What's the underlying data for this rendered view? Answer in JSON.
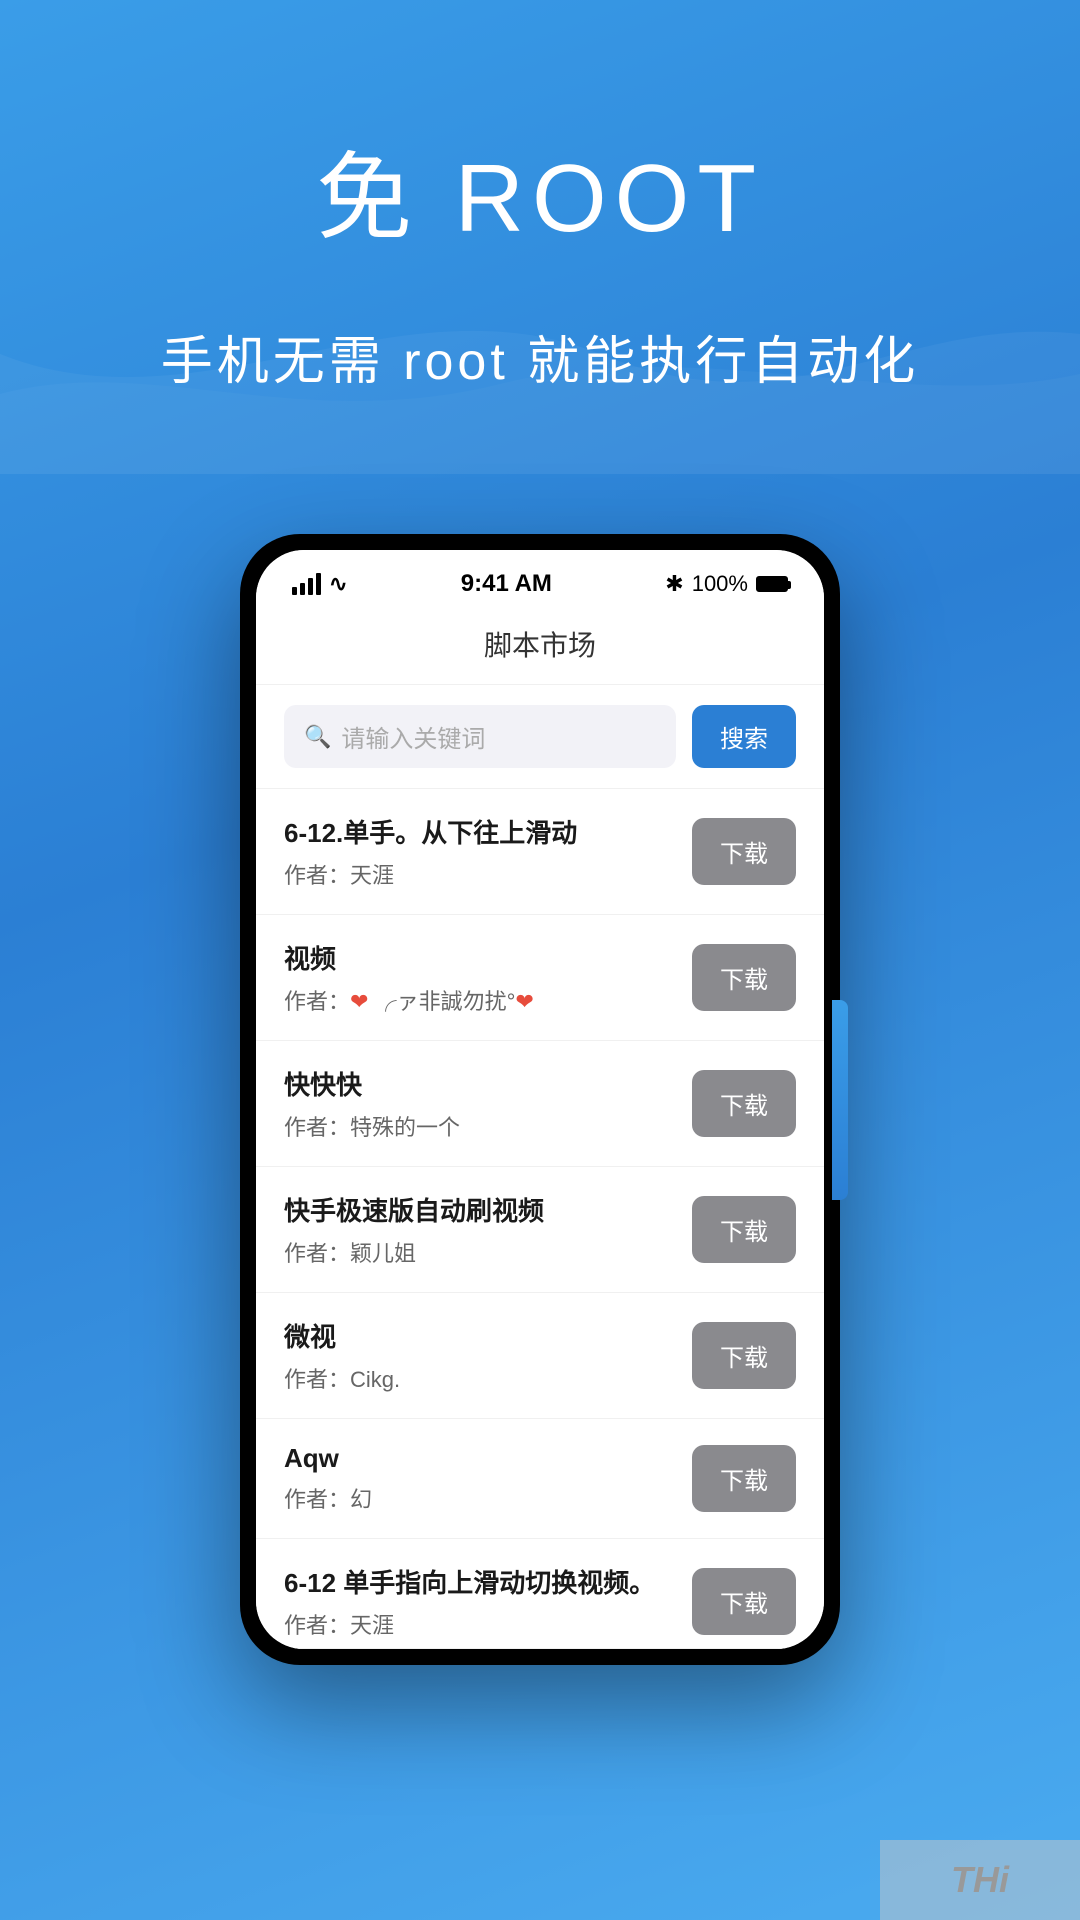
{
  "hero": {
    "title": "免 ROOT",
    "subtitle": "手机无需 root 就能执行自动化"
  },
  "phone": {
    "status_bar": {
      "time": "9:41 AM",
      "battery": "100%",
      "bluetooth": "✱"
    },
    "app_title": "脚本市场",
    "search": {
      "placeholder": "请输入关键词",
      "button_label": "搜索"
    },
    "scripts": [
      {
        "title": "6-12.单手。从下往上滑动",
        "author": "作者：天涯",
        "download_label": "下载"
      },
      {
        "title": "视频",
        "author_prefix": "作者：",
        "author_name": "❤ ╭ァ非誠勿扰°❤",
        "download_label": "下载"
      },
      {
        "title": "快快快",
        "author": "作者：特殊的一个",
        "download_label": "下载"
      },
      {
        "title": "快手极速版自动刷视频",
        "author": "作者：颖儿姐",
        "download_label": "下载"
      },
      {
        "title": "微视",
        "author": "作者：Cikg.",
        "download_label": "下载"
      },
      {
        "title": "Aqw",
        "author": "作者：幻",
        "download_label": "下载"
      },
      {
        "title": "6-12 单手指向上滑动切换视频。",
        "author": "作者：天涯",
        "download_label": "下载"
      }
    ]
  },
  "watermark": {
    "text": "THi"
  }
}
